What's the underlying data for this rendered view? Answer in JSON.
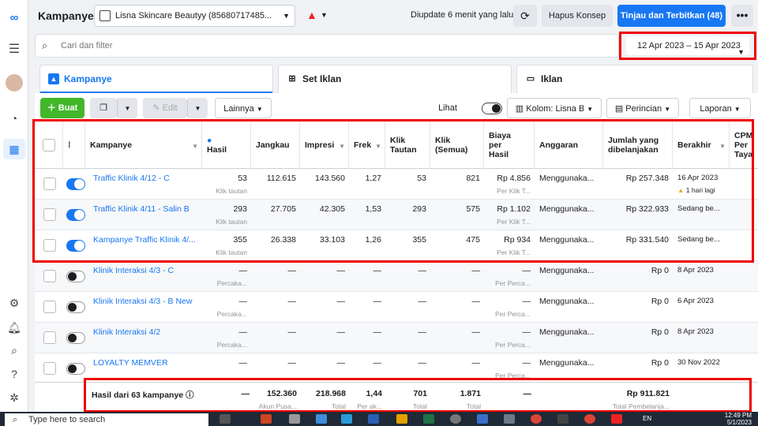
{
  "header": {
    "title": "Kampanye",
    "account_name": "Lisna Skincare Beautyy (85680717485...",
    "updated_text": "Diupdate 6 menit yang lalu",
    "discard_label": "Hapus Konsep",
    "publish_label": "Tinjau dan Terbitkan (48)",
    "more_label": "•••"
  },
  "search": {
    "placeholder": "Cari dan filter"
  },
  "date_range": "12 Apr 2023 – 15 Apr 2023",
  "tabs": [
    {
      "label": "Kampanye"
    },
    {
      "label": "Set Iklan"
    },
    {
      "label": "Iklan"
    }
  ],
  "toolbar": {
    "create_label": "Buat",
    "edit_label": "Edit",
    "more_label": "Lainnya",
    "preview_label": "Lihat Penyiapan",
    "columns_label": "Kolom: Lisna B",
    "breakdown_label": "Perincian",
    "reports_label": "Laporan"
  },
  "columns": {
    "campaign": "Kampanye",
    "results": "Hasil",
    "reach": "Jangkau",
    "impressions": "Impresi",
    "frequency": "Frek",
    "link_clicks": "Klik Tautan",
    "clicks_all": "Klik (Semua)",
    "cost_per_result": "Biaya per Hasil",
    "budget": "Anggaran",
    "amount_spent": "Jumlah yang dibelanjakan",
    "ends": "Berakhir",
    "cpm": "CPM Per Taya"
  },
  "rows": [
    {
      "name": "Traffic Klinik 4/12 - C",
      "active": true,
      "results": "53",
      "results_sub": "Klik tautan",
      "reach": "112.615",
      "impressions": "143.560",
      "frequency": "1,27",
      "link_clicks": "53",
      "clicks_all": "821",
      "cost": "Rp 4.856",
      "cost_sub": "Per Klik T...",
      "budget": "Menggunaka...",
      "spent": "Rp 257.348",
      "ends": "16 Apr 2023",
      "ends_sub": "1 hari lagi"
    },
    {
      "name": "Traffic Klinik 4/11 - Salin B",
      "active": true,
      "results": "293",
      "results_sub": "Klik tautan",
      "reach": "27.705",
      "impressions": "42.305",
      "frequency": "1,53",
      "link_clicks": "293",
      "clicks_all": "575",
      "cost": "Rp 1.102",
      "cost_sub": "Per Klik T...",
      "budget": "Menggunaka...",
      "spent": "Rp 322.933",
      "ends": "Sedang be...",
      "ends_sub": ""
    },
    {
      "name": "Kampanye Traffic Klinik 4/...",
      "active": true,
      "results": "355",
      "results_sub": "Klik tautan",
      "reach": "26.338",
      "impressions": "33.103",
      "frequency": "1,26",
      "link_clicks": "355",
      "clicks_all": "475",
      "cost": "Rp 934",
      "cost_sub": "Per Klik T...",
      "budget": "Menggunaka...",
      "spent": "Rp 331.540",
      "ends": "Sedang be...",
      "ends_sub": ""
    },
    {
      "name": "Klinik Interaksi 4/3 - C",
      "active": false,
      "results": "—",
      "results_sub": "Percaka...",
      "reach": "—",
      "impressions": "—",
      "frequency": "—",
      "link_clicks": "—",
      "clicks_all": "—",
      "cost": "—",
      "cost_sub": "Per Perca...",
      "budget": "Menggunaka...",
      "spent": "Rp 0",
      "ends": "8 Apr 2023",
      "ends_sub": ""
    },
    {
      "name": "Klinik Interaksi 4/3 - B New",
      "active": false,
      "results": "—",
      "results_sub": "Percaka...",
      "reach": "—",
      "impressions": "—",
      "frequency": "—",
      "link_clicks": "—",
      "clicks_all": "—",
      "cost": "—",
      "cost_sub": "Per Perca...",
      "budget": "Menggunaka...",
      "spent": "Rp 0",
      "ends": "6 Apr 2023",
      "ends_sub": ""
    },
    {
      "name": "Klinik Interaksi 4/2",
      "active": false,
      "results": "—",
      "results_sub": "Percaka...",
      "reach": "—",
      "impressions": "—",
      "frequency": "—",
      "link_clicks": "—",
      "clicks_all": "—",
      "cost": "—",
      "cost_sub": "Per Perca...",
      "budget": "Menggunaka...",
      "spent": "Rp 0",
      "ends": "8 Apr 2023",
      "ends_sub": ""
    },
    {
      "name": "LOYALTY MEMVER",
      "active": false,
      "results": "—",
      "results_sub": "",
      "reach": "—",
      "impressions": "—",
      "frequency": "—",
      "link_clicks": "—",
      "clicks_all": "—",
      "cost": "—",
      "cost_sub": "Per Perca...",
      "budget": "Menggunaka...",
      "spent": "Rp 0",
      "ends": "30 Nov 2022",
      "ends_sub": ""
    }
  ],
  "totals": {
    "label": "Hasil dari 63 kampanye",
    "results": "—",
    "reach": "152.360",
    "reach_sub": "Akun Pusa...",
    "impressions": "218.968",
    "impressions_sub": "Total",
    "frequency": "1,44",
    "frequency_sub": "Per ak...",
    "link_clicks": "701",
    "link_clicks_sub": "Total",
    "clicks_all": "1.871",
    "clicks_all_sub": "Total",
    "cost": "—",
    "spent": "Rp 911.821",
    "spent_sub": "Total Pembelanja..."
  },
  "taskbar": {
    "search_placeholder": "Type here to search",
    "lang": "EN",
    "time": "12:49 PM",
    "date": "5/1/2023"
  },
  "colors": {
    "accent": "#1877f2",
    "create": "#42b72a",
    "highlight": "#e00000"
  }
}
